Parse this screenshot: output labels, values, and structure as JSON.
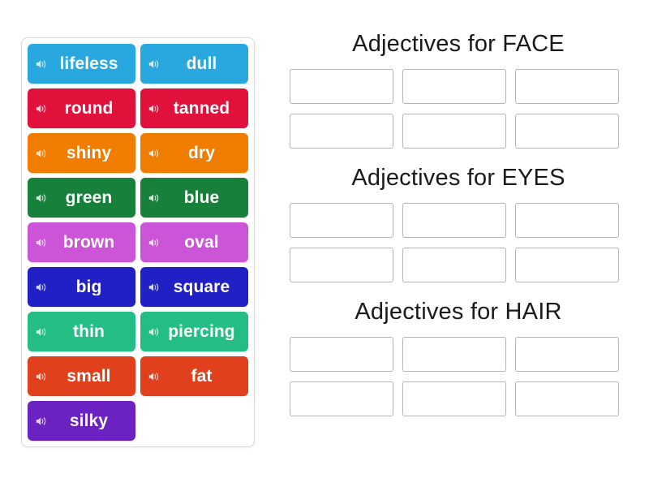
{
  "activity": {
    "type": "group-sort",
    "icon_name": "speaker-icon"
  },
  "word_bank": {
    "name": "word-bank",
    "tiles": [
      {
        "label": "lifeless",
        "color": "#29A8DF"
      },
      {
        "label": "dull",
        "color": "#29A8DF"
      },
      {
        "label": "round",
        "color": "#E0123C"
      },
      {
        "label": "tanned",
        "color": "#E0123C"
      },
      {
        "label": "shiny",
        "color": "#F07C00"
      },
      {
        "label": "dry",
        "color": "#F07C00"
      },
      {
        "label": "green",
        "color": "#17803A"
      },
      {
        "label": "blue",
        "color": "#17803A"
      },
      {
        "label": "brown",
        "color": "#CB55D6"
      },
      {
        "label": "oval",
        "color": "#CB55D6"
      },
      {
        "label": "big",
        "color": "#2020C4"
      },
      {
        "label": "square",
        "color": "#2020C4"
      },
      {
        "label": "thin",
        "color": "#24BD84"
      },
      {
        "label": "piercing",
        "color": "#24BD84"
      },
      {
        "label": "small",
        "color": "#E0401C"
      },
      {
        "label": "fat",
        "color": "#E0401C"
      },
      {
        "label": "silky",
        "color": "#6B22C0"
      }
    ]
  },
  "groups": [
    {
      "title": "Adjectives for FACE",
      "slots": [
        "",
        "",
        "",
        "",
        "",
        ""
      ]
    },
    {
      "title": "Adjectives for EYES",
      "slots": [
        "",
        "",
        "",
        "",
        "",
        ""
      ]
    },
    {
      "title": "Adjectives for HAIR",
      "slots": [
        "",
        "",
        "",
        "",
        "",
        ""
      ]
    }
  ]
}
